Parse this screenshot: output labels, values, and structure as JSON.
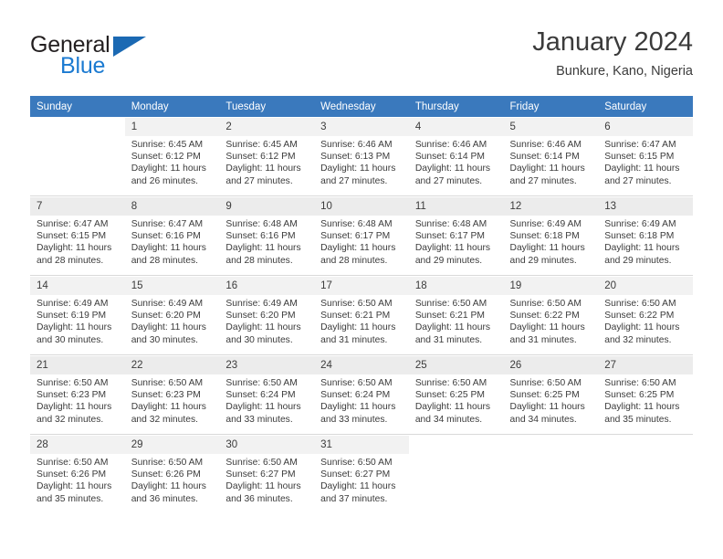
{
  "brand": {
    "word_one": "General",
    "word_two": "Blue",
    "triangle_color": "#1b69b3",
    "blue_color": "#1b7ad1",
    "dark_color": "#231f20"
  },
  "header": {
    "title": "January 2024",
    "subtitle": "Bunkure, Kano, Nigeria"
  },
  "theme": {
    "header_bg": "#3a79bd",
    "header_text": "#ffffff",
    "cell_label_bg": "#f2f2f2",
    "text": "#3b3b3b"
  },
  "weekday_headers": [
    "Sunday",
    "Monday",
    "Tuesday",
    "Wednesday",
    "Thursday",
    "Friday",
    "Saturday"
  ],
  "labels": {
    "sunrise_prefix": "Sunrise:",
    "sunset_prefix": "Sunset:",
    "daylight_prefix": "Daylight:"
  },
  "weeks": [
    {
      "days": [
        {
          "day": "",
          "sunrise": "",
          "sunset": "",
          "daylight_line1": "",
          "daylight_line2": ""
        },
        {
          "day": "1",
          "sunrise": "Sunrise: 6:45 AM",
          "sunset": "Sunset: 6:12 PM",
          "daylight_line1": "Daylight: 11 hours",
          "daylight_line2": "and 26 minutes."
        },
        {
          "day": "2",
          "sunrise": "Sunrise: 6:45 AM",
          "sunset": "Sunset: 6:12 PM",
          "daylight_line1": "Daylight: 11 hours",
          "daylight_line2": "and 27 minutes."
        },
        {
          "day": "3",
          "sunrise": "Sunrise: 6:46 AM",
          "sunset": "Sunset: 6:13 PM",
          "daylight_line1": "Daylight: 11 hours",
          "daylight_line2": "and 27 minutes."
        },
        {
          "day": "4",
          "sunrise": "Sunrise: 6:46 AM",
          "sunset": "Sunset: 6:14 PM",
          "daylight_line1": "Daylight: 11 hours",
          "daylight_line2": "and 27 minutes."
        },
        {
          "day": "5",
          "sunrise": "Sunrise: 6:46 AM",
          "sunset": "Sunset: 6:14 PM",
          "daylight_line1": "Daylight: 11 hours",
          "daylight_line2": "and 27 minutes."
        },
        {
          "day": "6",
          "sunrise": "Sunrise: 6:47 AM",
          "sunset": "Sunset: 6:15 PM",
          "daylight_line1": "Daylight: 11 hours",
          "daylight_line2": "and 27 minutes."
        }
      ]
    },
    {
      "days": [
        {
          "day": "7",
          "sunrise": "Sunrise: 6:47 AM",
          "sunset": "Sunset: 6:15 PM",
          "daylight_line1": "Daylight: 11 hours",
          "daylight_line2": "and 28 minutes."
        },
        {
          "day": "8",
          "sunrise": "Sunrise: 6:47 AM",
          "sunset": "Sunset: 6:16 PM",
          "daylight_line1": "Daylight: 11 hours",
          "daylight_line2": "and 28 minutes."
        },
        {
          "day": "9",
          "sunrise": "Sunrise: 6:48 AM",
          "sunset": "Sunset: 6:16 PM",
          "daylight_line1": "Daylight: 11 hours",
          "daylight_line2": "and 28 minutes."
        },
        {
          "day": "10",
          "sunrise": "Sunrise: 6:48 AM",
          "sunset": "Sunset: 6:17 PM",
          "daylight_line1": "Daylight: 11 hours",
          "daylight_line2": "and 28 minutes."
        },
        {
          "day": "11",
          "sunrise": "Sunrise: 6:48 AM",
          "sunset": "Sunset: 6:17 PM",
          "daylight_line1": "Daylight: 11 hours",
          "daylight_line2": "and 29 minutes."
        },
        {
          "day": "12",
          "sunrise": "Sunrise: 6:49 AM",
          "sunset": "Sunset: 6:18 PM",
          "daylight_line1": "Daylight: 11 hours",
          "daylight_line2": "and 29 minutes."
        },
        {
          "day": "13",
          "sunrise": "Sunrise: 6:49 AM",
          "sunset": "Sunset: 6:18 PM",
          "daylight_line1": "Daylight: 11 hours",
          "daylight_line2": "and 29 minutes."
        }
      ]
    },
    {
      "days": [
        {
          "day": "14",
          "sunrise": "Sunrise: 6:49 AM",
          "sunset": "Sunset: 6:19 PM",
          "daylight_line1": "Daylight: 11 hours",
          "daylight_line2": "and 30 minutes."
        },
        {
          "day": "15",
          "sunrise": "Sunrise: 6:49 AM",
          "sunset": "Sunset: 6:20 PM",
          "daylight_line1": "Daylight: 11 hours",
          "daylight_line2": "and 30 minutes."
        },
        {
          "day": "16",
          "sunrise": "Sunrise: 6:49 AM",
          "sunset": "Sunset: 6:20 PM",
          "daylight_line1": "Daylight: 11 hours",
          "daylight_line2": "and 30 minutes."
        },
        {
          "day": "17",
          "sunrise": "Sunrise: 6:50 AM",
          "sunset": "Sunset: 6:21 PM",
          "daylight_line1": "Daylight: 11 hours",
          "daylight_line2": "and 31 minutes."
        },
        {
          "day": "18",
          "sunrise": "Sunrise: 6:50 AM",
          "sunset": "Sunset: 6:21 PM",
          "daylight_line1": "Daylight: 11 hours",
          "daylight_line2": "and 31 minutes."
        },
        {
          "day": "19",
          "sunrise": "Sunrise: 6:50 AM",
          "sunset": "Sunset: 6:22 PM",
          "daylight_line1": "Daylight: 11 hours",
          "daylight_line2": "and 31 minutes."
        },
        {
          "day": "20",
          "sunrise": "Sunrise: 6:50 AM",
          "sunset": "Sunset: 6:22 PM",
          "daylight_line1": "Daylight: 11 hours",
          "daylight_line2": "and 32 minutes."
        }
      ]
    },
    {
      "days": [
        {
          "day": "21",
          "sunrise": "Sunrise: 6:50 AM",
          "sunset": "Sunset: 6:23 PM",
          "daylight_line1": "Daylight: 11 hours",
          "daylight_line2": "and 32 minutes."
        },
        {
          "day": "22",
          "sunrise": "Sunrise: 6:50 AM",
          "sunset": "Sunset: 6:23 PM",
          "daylight_line1": "Daylight: 11 hours",
          "daylight_line2": "and 32 minutes."
        },
        {
          "day": "23",
          "sunrise": "Sunrise: 6:50 AM",
          "sunset": "Sunset: 6:24 PM",
          "daylight_line1": "Daylight: 11 hours",
          "daylight_line2": "and 33 minutes."
        },
        {
          "day": "24",
          "sunrise": "Sunrise: 6:50 AM",
          "sunset": "Sunset: 6:24 PM",
          "daylight_line1": "Daylight: 11 hours",
          "daylight_line2": "and 33 minutes."
        },
        {
          "day": "25",
          "sunrise": "Sunrise: 6:50 AM",
          "sunset": "Sunset: 6:25 PM",
          "daylight_line1": "Daylight: 11 hours",
          "daylight_line2": "and 34 minutes."
        },
        {
          "day": "26",
          "sunrise": "Sunrise: 6:50 AM",
          "sunset": "Sunset: 6:25 PM",
          "daylight_line1": "Daylight: 11 hours",
          "daylight_line2": "and 34 minutes."
        },
        {
          "day": "27",
          "sunrise": "Sunrise: 6:50 AM",
          "sunset": "Sunset: 6:25 PM",
          "daylight_line1": "Daylight: 11 hours",
          "daylight_line2": "and 35 minutes."
        }
      ]
    },
    {
      "days": [
        {
          "day": "28",
          "sunrise": "Sunrise: 6:50 AM",
          "sunset": "Sunset: 6:26 PM",
          "daylight_line1": "Daylight: 11 hours",
          "daylight_line2": "and 35 minutes."
        },
        {
          "day": "29",
          "sunrise": "Sunrise: 6:50 AM",
          "sunset": "Sunset: 6:26 PM",
          "daylight_line1": "Daylight: 11 hours",
          "daylight_line2": "and 36 minutes."
        },
        {
          "day": "30",
          "sunrise": "Sunrise: 6:50 AM",
          "sunset": "Sunset: 6:27 PM",
          "daylight_line1": "Daylight: 11 hours",
          "daylight_line2": "and 36 minutes."
        },
        {
          "day": "31",
          "sunrise": "Sunrise: 6:50 AM",
          "sunset": "Sunset: 6:27 PM",
          "daylight_line1": "Daylight: 11 hours",
          "daylight_line2": "and 37 minutes."
        },
        {
          "day": "",
          "sunrise": "",
          "sunset": "",
          "daylight_line1": "",
          "daylight_line2": ""
        },
        {
          "day": "",
          "sunrise": "",
          "sunset": "",
          "daylight_line1": "",
          "daylight_line2": ""
        },
        {
          "day": "",
          "sunrise": "",
          "sunset": "",
          "daylight_line1": "",
          "daylight_line2": ""
        }
      ]
    }
  ]
}
